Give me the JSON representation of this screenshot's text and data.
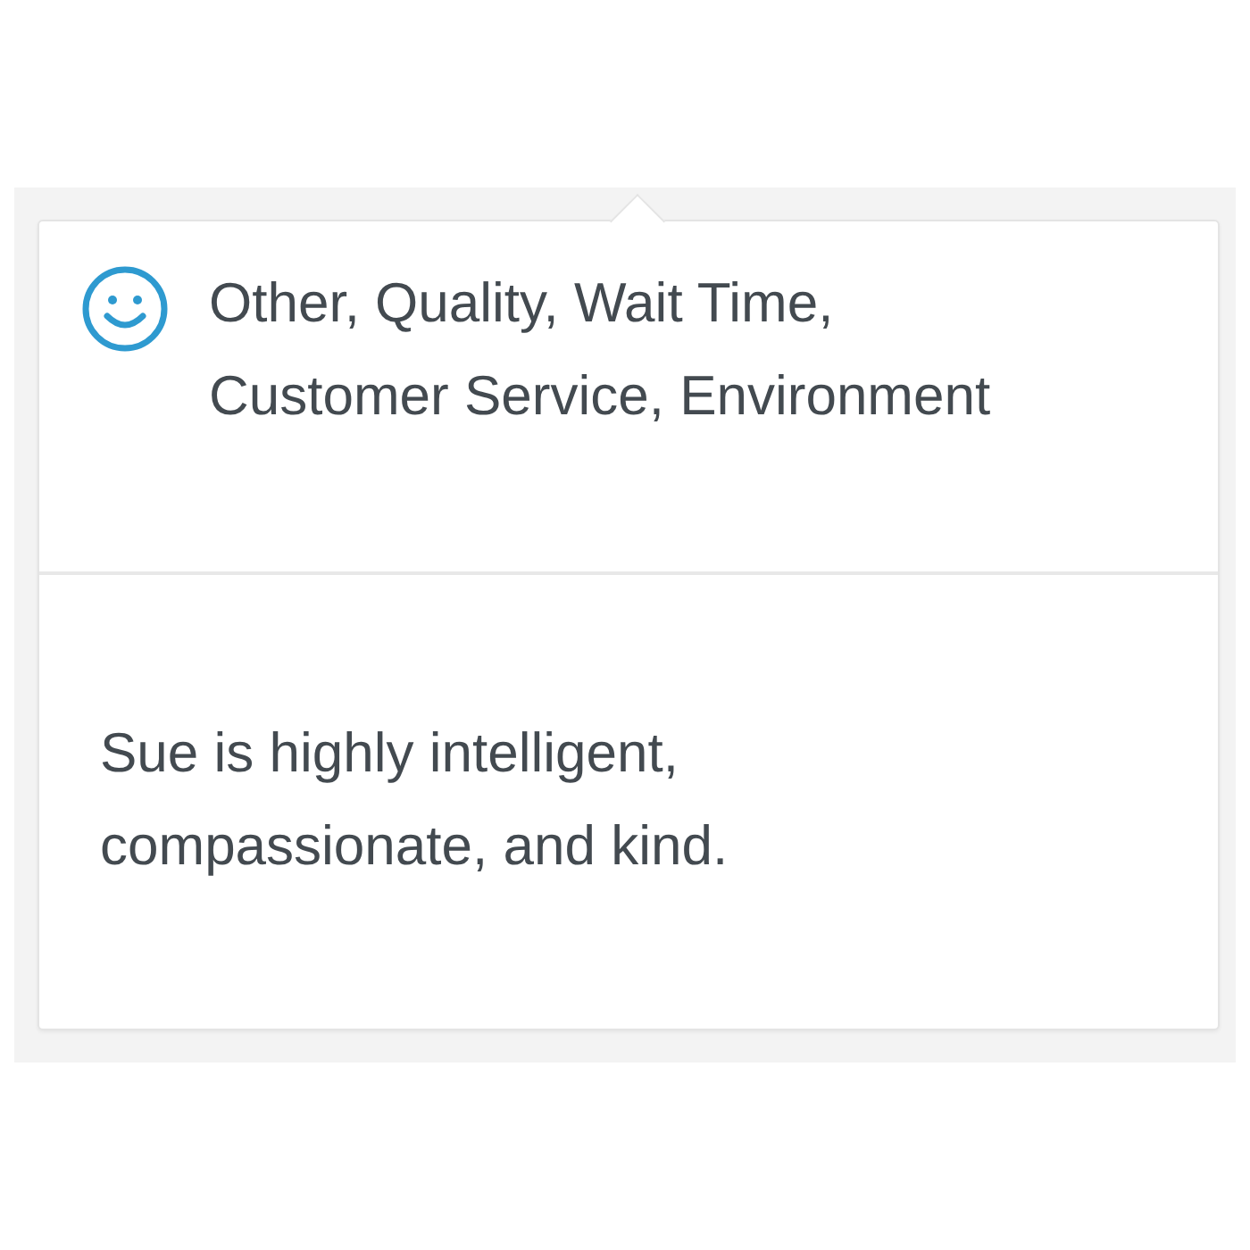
{
  "popover": {
    "categories": "Other, Quality, Wait Time, Customer Service, Environment",
    "comment": "Sue is highly intelligent, compassionate, and kind."
  }
}
